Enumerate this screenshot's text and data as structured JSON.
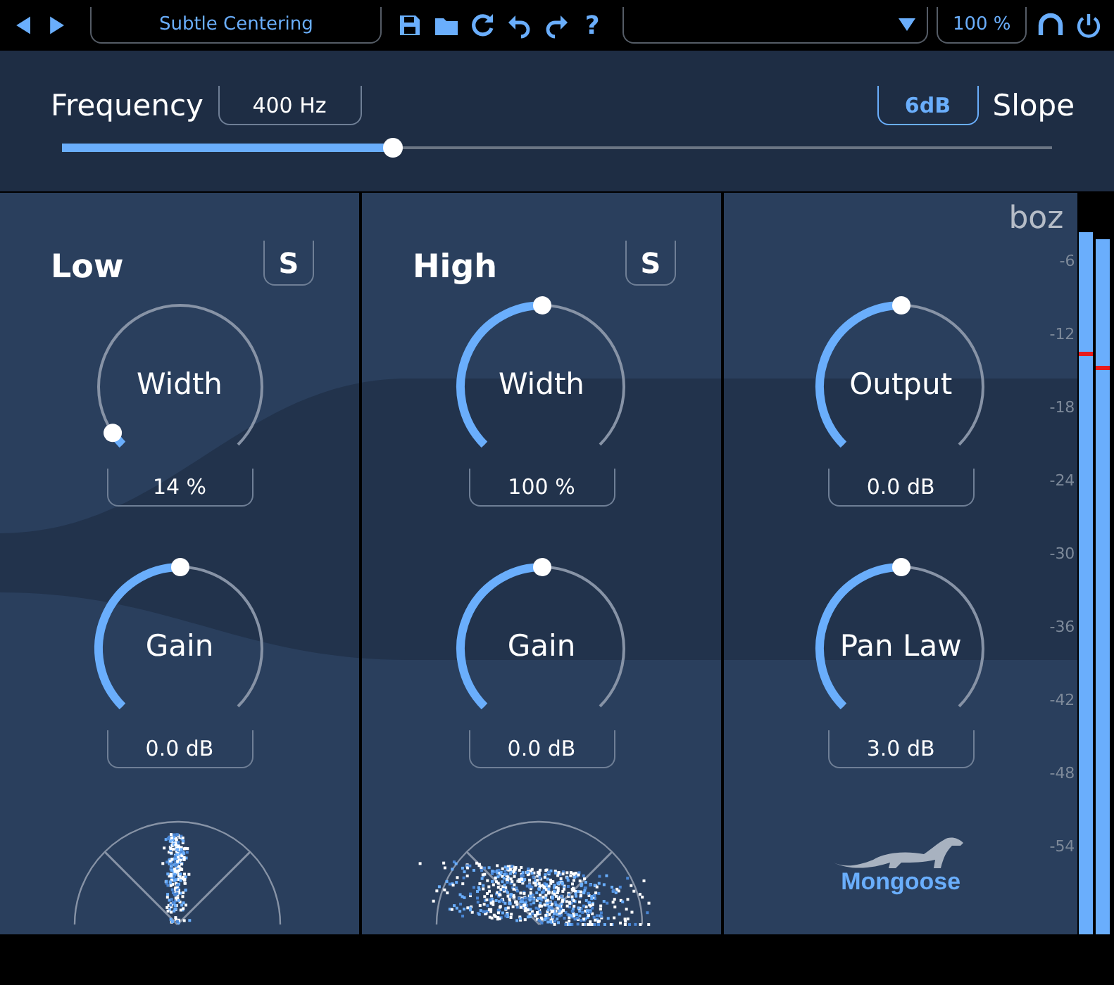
{
  "toolbar": {
    "preset": "Subtle Centering",
    "help": "?",
    "zoom": "100 %"
  },
  "header": {
    "frequency_label": "Frequency",
    "frequency_value": "400 Hz",
    "frequency_slider": {
      "level": 0.33
    },
    "slope_button": "6dB",
    "slope_label": "Slope"
  },
  "bands": [
    {
      "title": "Low",
      "solo": "S",
      "knobs": [
        {
          "label": "Width",
          "value": "14 %",
          "level": 0.04
        },
        {
          "label": "Gain",
          "value": "0.0 dB",
          "level": 0.5
        }
      ]
    },
    {
      "title": "High",
      "solo": "S",
      "knobs": [
        {
          "label": "Width",
          "value": "100 %",
          "level": 0.5
        },
        {
          "label": "Gain",
          "value": "0.0 dB",
          "level": 0.5
        }
      ]
    }
  ],
  "output": {
    "logo": "boz",
    "knobs": [
      {
        "label": "Output",
        "value": "0.0 dB",
        "level": 0.5
      },
      {
        "label": "Pan Law",
        "value": "3.0 dB",
        "level": 0.5
      }
    ],
    "brand": "Mongoose"
  },
  "meter_scale": [
    "-6",
    "-12",
    "-18",
    "-24",
    "-30",
    "-36",
    "-42",
    "-48",
    "-54"
  ],
  "meters": [
    {
      "level": 0.947,
      "peak": {
        "level": 0.78
      }
    },
    {
      "level": 0.937,
      "peak": {
        "level": 0.76
      }
    }
  ]
}
